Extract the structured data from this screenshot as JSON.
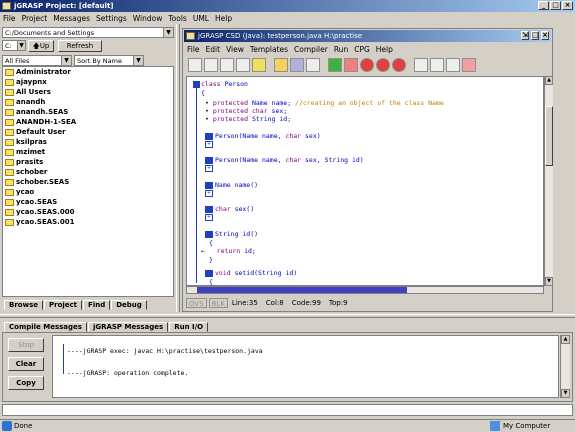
{
  "app": {
    "title": "jGRASP  Project: [default]"
  },
  "menu": [
    "File",
    "Project",
    "Messages",
    "Settings",
    "Window",
    "Tools",
    "UML",
    "Help"
  ],
  "browse": {
    "path": "C:/Documents and Settings",
    "drive": "C:",
    "up_label": "Up",
    "refresh_label": "Refresh",
    "filter": "All Files",
    "sort": "Sort By Name",
    "items": [
      "Administrator",
      "ajaypnx",
      "All Users",
      "anandh",
      "anandh.SEAS",
      "ANANDH-1-SEA",
      "Default User",
      "ksilpras",
      "mzimet",
      "prasits",
      "schober",
      "schober.SEAS",
      "ycao",
      "ycao.SEAS",
      "ycao.SEAS.000",
      "ycao.SEAS.001"
    ],
    "tabs": [
      "Browse",
      "Project",
      "Find",
      "Debug"
    ]
  },
  "editor": {
    "title": "jGRASP CSD (Java):  testperson.java  H:\\practise",
    "menu": [
      "File",
      "Edit",
      "View",
      "Templates",
      "Compiler",
      "Run",
      "CPG",
      "Help"
    ],
    "status": {
      "ovs": "OVS",
      "blk": "BLK",
      "line": "Line:35",
      "col": "Col:8",
      "code": "Code:99",
      "top": "Top:9"
    }
  },
  "code": {
    "l1a": "class",
    "l1b": " Person",
    "l2": "{",
    "l3a": "protected",
    "l3b": " Name name; ",
    "l3c": "//creating an object of the class Name",
    "l4a": "protected",
    "l4b": " char",
    "l4c": " sex;",
    "l5a": "protected",
    "l5b": " String id;",
    "l6a": "Person(Name name, ",
    "l6b": "char",
    "l6c": " sex)",
    "l7a": "Person(Name name, ",
    "l7b": "char",
    "l7c": " sex, String id)",
    "l8": "Name name()",
    "l9a": "char",
    "l9b": " sex()",
    "l10": "String id()",
    "l11": "{",
    "l12a": "return",
    "l12b": " id;",
    "l13": "}",
    "l14a": "void",
    "l14b": " setid(String id)",
    "l15": "{"
  },
  "messages": {
    "tabs": [
      "Compile Messages",
      "jGRASP Messages",
      "Run I/O"
    ],
    "stop": "Stop",
    "clear": "Clear",
    "copy": "Copy",
    "line1": "----jGRASP exec: javac H:\\practise\\testperson.java",
    "line2": "----jGRASP: operation complete."
  },
  "statusbar": {
    "done": "Done",
    "zone": "My Computer"
  }
}
